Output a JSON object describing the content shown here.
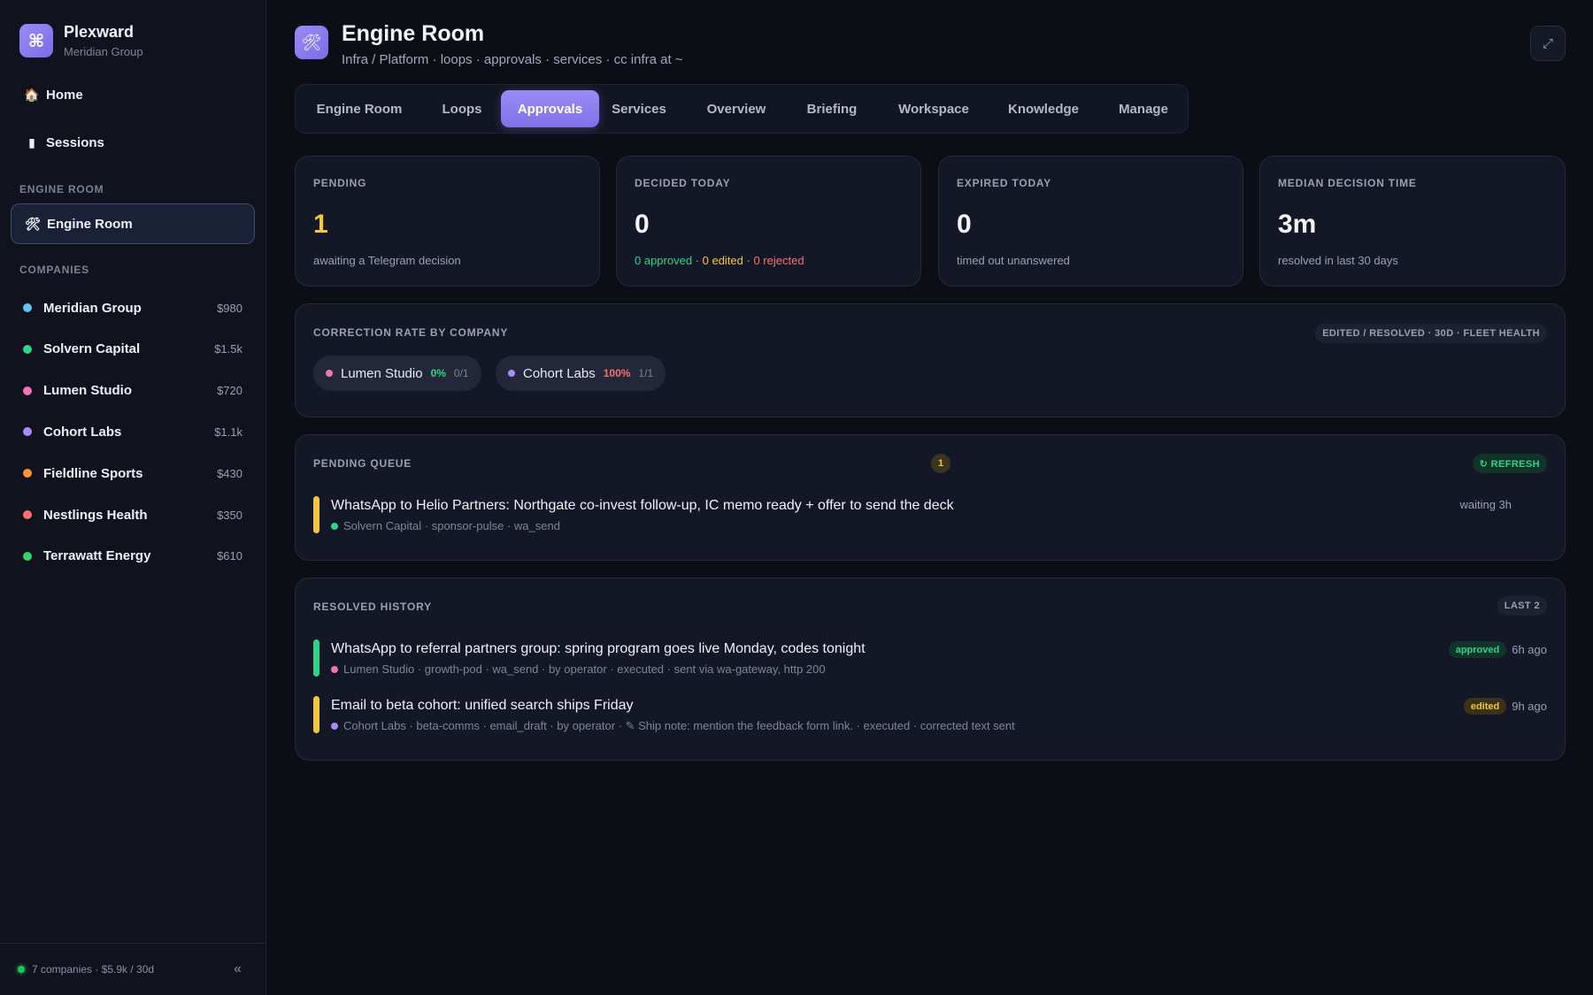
{
  "brand": {
    "name": "Plexward",
    "org": "Meridian Group",
    "logo_icon": "command-icon"
  },
  "nav": {
    "home": {
      "icon": "🏠",
      "label": "Home"
    },
    "sessions": {
      "icon": "▮",
      "label": "Sessions"
    },
    "engine_section": "ENGINE ROOM",
    "engine_room": {
      "icon": "🛠",
      "label": "Engine Room"
    },
    "companies_section": "COMPANIES"
  },
  "companies": [
    {
      "name": "Meridian Group",
      "amount": "$980",
      "color": "#5ec6f5"
    },
    {
      "name": "Solvern Capital",
      "amount": "$1.5k",
      "color": "#2fd38a"
    },
    {
      "name": "Lumen Studio",
      "amount": "$720",
      "color": "#f472b6"
    },
    {
      "name": "Cohort Labs",
      "amount": "$1.1k",
      "color": "#a78bfa"
    },
    {
      "name": "Fieldline Sports",
      "amount": "$430",
      "color": "#fb923c"
    },
    {
      "name": "Nestlings Health",
      "amount": "$350",
      "color": "#f87171"
    },
    {
      "name": "Terrawatt Energy",
      "amount": "$610",
      "color": "#34d36b"
    }
  ],
  "footer": {
    "summary": "7 companies · $5.9k / 30d",
    "collapse": "«"
  },
  "header": {
    "icon": "🛠",
    "title": "Engine Room",
    "subtitle": "Infra / Platform · loops · approvals · services · cc infra at ~",
    "expand": "⤢"
  },
  "tabs": [
    "Engine Room",
    "Loops",
    "Approvals",
    "Services",
    "Overview",
    "Briefing",
    "Workspace",
    "Knowledge",
    "Manage"
  ],
  "active_tab": "Approvals",
  "stats": {
    "pending": {
      "label": "PENDING",
      "value": "1",
      "note": "awaiting a Telegram decision"
    },
    "decided": {
      "label": "DECIDED TODAY",
      "value": "0",
      "approved": "0 approved",
      "edited": "0 edited",
      "rejected": "0 rejected",
      "sep": " · "
    },
    "expired": {
      "label": "EXPIRED TODAY",
      "value": "0",
      "note": "timed out unanswered"
    },
    "median": {
      "label": "MEDIAN DECISION TIME",
      "value": "3m",
      "note": "resolved in last 30 days"
    }
  },
  "correction": {
    "label": "CORRECTION RATE BY COMPANY",
    "tag": "EDITED / RESOLVED · 30D · FLEET HEALTH",
    "items": [
      {
        "name": "Lumen Studio",
        "pct": "0%",
        "frac": "0/1",
        "dot": "#f472b6",
        "pct_color": "#2fd38a"
      },
      {
        "name": "Cohort Labs",
        "pct": "100%",
        "frac": "1/1",
        "dot": "#a78bfa",
        "pct_color": "#f87171"
      }
    ]
  },
  "queue": {
    "label": "PENDING QUEUE",
    "count": "1",
    "refresh": "↻ REFRESH",
    "items": [
      {
        "title": "WhatsApp to Helio Partners: Northgate co-invest follow-up, IC memo ready + offer to send the deck",
        "meta": "Solvern Capital · sponsor-pulse · wa_send",
        "dot": "#2fd38a",
        "bar": "#f5c53a",
        "right": "waiting 3h"
      }
    ]
  },
  "history": {
    "label": "RESOLVED HISTORY",
    "tag": "LAST 2",
    "items": [
      {
        "title": "WhatsApp to referral partners group: spring program goes live Monday, codes tonight",
        "meta": "Lumen Studio · growth-pod · wa_send · by operator · executed · sent via wa-gateway, http 200",
        "dot": "#f472b6",
        "bar": "#2fd38a",
        "status": "approved",
        "time": "6h ago"
      },
      {
        "title": "Email to beta cohort: unified search ships Friday",
        "meta": "Cohort Labs · beta-comms · email_draft · by operator · ✎ Ship note: mention the feedback form link. · executed · corrected text sent",
        "dot": "#a78bfa",
        "bar": "#f5c53a",
        "status": "edited",
        "time": "9h ago"
      }
    ]
  }
}
